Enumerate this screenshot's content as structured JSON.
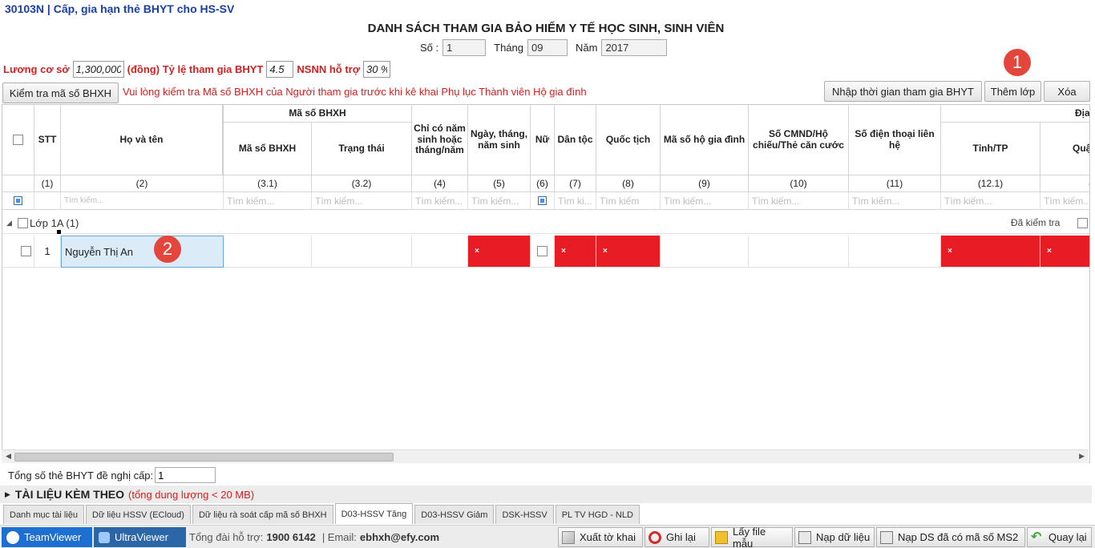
{
  "window": {
    "title": "30103N | Cấp, gia hạn thẻ BHYT cho HS-SV"
  },
  "header": {
    "main_title": "DANH SÁCH THAM GIA BẢO HIỂM Y TẾ HỌC SINH, SINH VIÊN",
    "so_label": "Số :",
    "so_value": "1",
    "thang_label": "Tháng",
    "thang_value": "09",
    "nam_label": "Năm",
    "nam_value": "2017"
  },
  "params": {
    "luong_label": "Lương cơ sở",
    "luong_value": "1,300,000",
    "dong_label": "(đồng) Tỷ lệ tham gia BHYT",
    "tyle_value": "4.5",
    "nsnn_label": "NSNN hỗ trợ",
    "nsnn_value": "30 %"
  },
  "toolbar": {
    "check_bhxh": "Kiểm tra mã số BHXH",
    "notice": "Vui lòng kiểm tra Mã số BHXH của Người tham gia trước khi kê khai Phụ lục Thành viên Hộ gia đình",
    "nhap_thoi_gian": "Nhập thời gian tham gia BHYT",
    "them_lop": "Thêm lớp",
    "xoa": "Xóa"
  },
  "badges": {
    "one": "1",
    "two": "2"
  },
  "grid": {
    "headers": {
      "stt": "STT",
      "ho_ten": "Họ và tên",
      "ma_so_bhxh_group": "Mã số BHXH",
      "ma_so_bhxh": "Mã số BHXH",
      "trang_thai": "Trạng thái",
      "chi_co_nam": "Chỉ có năm sinh hoặc tháng/năm",
      "ngay_sinh": "Ngày, tháng, năm sinh",
      "nu": "Nữ",
      "dan_toc": "Dân tộc",
      "quoc_tich": "Quốc tịch",
      "ma_ho_gd": "Mã số hộ gia đình",
      "cmnd": "Số CMND/Hộ chiếu/Thẻ căn cước",
      "sdt": "Số điện thoại liên hệ",
      "dia_chi_group": "Địa chỉ h",
      "tinh_tp": "Tỉnh/TP",
      "quan": "Quậ"
    },
    "numbers": [
      "(1)",
      "(2)",
      "(3.1)",
      "(3.2)",
      "(4)",
      "(5)",
      "(6)",
      "(7)",
      "(8)",
      "(9)",
      "(10)",
      "(11)",
      "(12.1)",
      "("
    ],
    "search_placeholder": "Tìm kiếm...",
    "search_short": "Tìm ki...",
    "search_mid": "Tìm kiếm",
    "group": {
      "label": "Lớp 1A (1)",
      "checked_label": "Đã kiểm tra"
    },
    "rows": [
      {
        "stt": "1",
        "ho_ten": "Nguyễn Thị An",
        "error_mark": "×"
      }
    ]
  },
  "summary": {
    "label": "Tổng số thẻ BHYT đề nghị cấp:",
    "value": "1"
  },
  "attachments": {
    "title": "TÀI LIỆU KÈM THEO",
    "note": "(tổng dung lượng < 20 MB)"
  },
  "tabs": [
    {
      "label": "Danh mục tài liệu"
    },
    {
      "label": "Dữ liệu HSSV (ECloud)"
    },
    {
      "label": "Dữ liệu rà soát cấp mã số BHXH"
    },
    {
      "label": "D03-HSSV Tăng"
    },
    {
      "label": "D03-HSSV Giảm"
    },
    {
      "label": "DSK-HSSV"
    },
    {
      "label": "PL TV HGD - NLD"
    }
  ],
  "footer": {
    "teamviewer": "TeamViewer",
    "ultraviewer": "UltraViewer",
    "hotline_label": "Tổng đài hỗ trợ:",
    "hotline": "1900 6142",
    "email_label": "| Email:",
    "email": "ebhxh@efy.com",
    "buttons": {
      "xuat": "Xuất tờ khai",
      "ghi": "Ghi lại",
      "lay_file": "Lấy file mẫu",
      "nap": "Nạp dữ liệu",
      "nap_ds": "Nạp DS đã có mã số MS2",
      "quay_lai": "Quay lại"
    }
  },
  "colors": {
    "error_red": "#e81c24",
    "title_blue": "#1a3fa6",
    "label_red": "#d32020",
    "badge": "#e5463b"
  }
}
